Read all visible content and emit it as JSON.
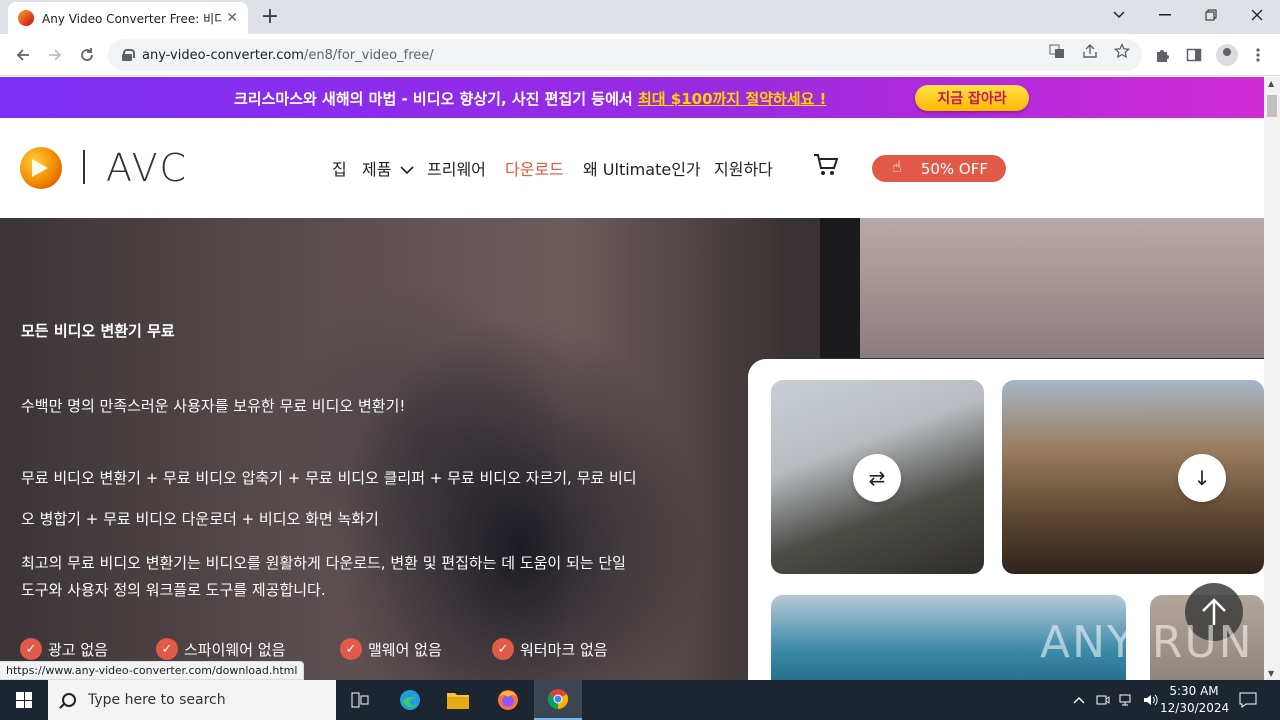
{
  "browser": {
    "tab_title": "Any Video Converter Free: 비디오",
    "tab_close": "✕",
    "new_tab": "+",
    "url_host": "any-video-converter.com",
    "url_path": "/en8/for_video_free/",
    "status_url": "https://www.any-video-converter.com/download.html"
  },
  "promo": {
    "text_before": "크리스마스와 새해의 마법 - 비디오 향상기, 사진 편집기 등에서 ",
    "highlight": "최대 $100까지 절약하세요 !",
    "cta": "지금 잡아라"
  },
  "header": {
    "logo_text": "AVC",
    "nav": {
      "home": "집",
      "products": "제품",
      "freeware": "프리웨어",
      "download": "다운로드",
      "why_ultimate": "왜 Ultimate인가",
      "support": "지원하다"
    },
    "offer": "50% OFF"
  },
  "hero": {
    "title": "모든 비디오 변환기 무료",
    "line1": "수백만 명의 만족스러운 사용자를 보유한 무료 비디오 변환기!",
    "line2": "무료 비디오 변환기 + 무료 비디오 압축기 + 무료 비디오 클리퍼 + 무료 비디오 자르기, 무료 비디",
    "line3": "오 병합기 + 무료 비디오 다운로더 + 비디오 화면 녹화기",
    "line4": "최고의 무료 비디오 변환기는 비디오를 원활하게 다운로드, 변환 및 편집하는 데 도움이 되는 단일",
    "line5": "도구와 사용자 정의 워크플로 도구를 제공합니다.",
    "features": [
      "광고 없음",
      "스파이웨어 없음",
      "맬웨어 없음",
      "워터마크 없음"
    ]
  },
  "watermark": "ANY RUN",
  "taskbar": {
    "search_placeholder": "Type here to search",
    "time": "5:30 AM",
    "date": "12/30/2024"
  },
  "colors": {
    "accent": "#e05a47",
    "promo_highlight": "#ffd200",
    "taskbar": "#1c2631"
  }
}
